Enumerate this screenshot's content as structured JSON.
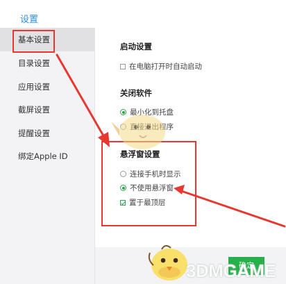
{
  "window": {
    "title": "设置"
  },
  "sidebar": {
    "items": [
      {
        "label": "基本设置",
        "active": true
      },
      {
        "label": "目录设置",
        "active": false
      },
      {
        "label": "应用设置",
        "active": false
      },
      {
        "label": "截屏设置",
        "active": false
      },
      {
        "label": "提醒设置",
        "active": false
      },
      {
        "label": "绑定Apple ID",
        "active": false
      }
    ]
  },
  "sections": {
    "startup": {
      "title": "启动设置",
      "options": [
        {
          "label": "在电脑打开时自动启动",
          "type": "checkbox",
          "checked": false
        }
      ]
    },
    "close": {
      "title": "关闭软件",
      "options": [
        {
          "label": "最小化到托盘",
          "type": "radio",
          "checked": true
        },
        {
          "label": "直接退出程序",
          "type": "radio",
          "checked": false
        }
      ]
    },
    "floating": {
      "title": "悬浮窗设置",
      "options": [
        {
          "label": "连接手机时显示",
          "type": "radio",
          "checked": false
        },
        {
          "label": "不使用悬浮窗",
          "type": "radio",
          "checked": true
        },
        {
          "label": "置于最顶层",
          "type": "checkbox",
          "checked": true
        }
      ]
    }
  },
  "footer": {
    "ok_label": "确定"
  },
  "watermark": {
    "text_a": "3DM",
    "text_b": "GAME"
  },
  "colors": {
    "accent": "#2c8fdc",
    "annotation": "#e8372f",
    "primary_button": "#26b04a"
  }
}
